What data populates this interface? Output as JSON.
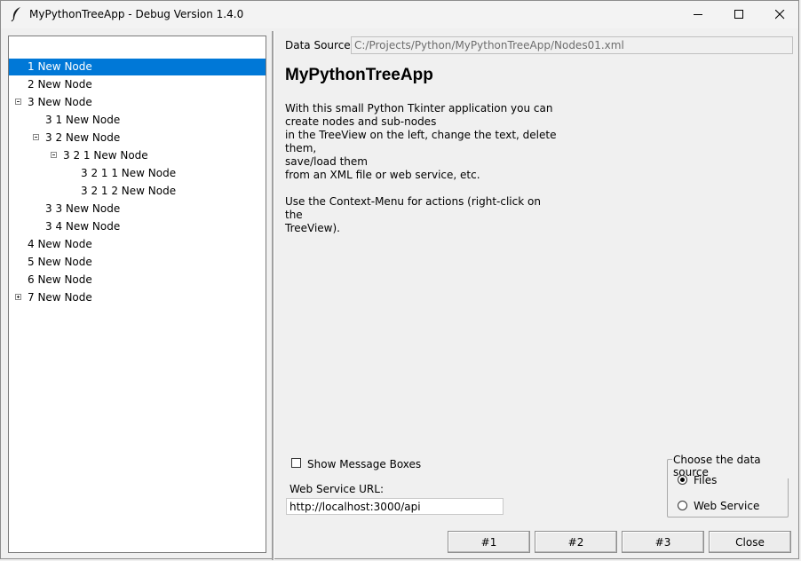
{
  "window": {
    "title": "MyPythonTreeApp - Debug Version 1.4.0"
  },
  "tree": {
    "nodes": [
      {
        "label": "1 New Node",
        "selected": true
      },
      {
        "label": "2 New Node"
      },
      {
        "label": "3 New Node",
        "expander": "minus"
      },
      {
        "label": "3 1 New Node"
      },
      {
        "label": "3 2 New Node",
        "expander": "minus"
      },
      {
        "label": "3 2 1 New Node",
        "expander": "minus"
      },
      {
        "label": "3 2 1 1 New Node"
      },
      {
        "label": "3 2 1 2 New Node"
      },
      {
        "label": "3 3 New Node"
      },
      {
        "label": "3 4 New Node"
      },
      {
        "label": "4 New Node"
      },
      {
        "label": "5 New Node"
      },
      {
        "label": "6 New Node"
      },
      {
        "label": "7 New Node",
        "expander": "plus"
      }
    ]
  },
  "data_source": {
    "label": "Data Source:",
    "value": "C:/Projects/Python/MyPythonTreeApp/Nodes01.xml"
  },
  "main": {
    "heading": "MyPythonTreeApp",
    "description": "With this small Python Tkinter application you can\ncreate nodes and sub-nodes\nin the TreeView on the left, change the text, delete them,\nsave/load them\nfrom an XML file or web service, etc.\n\nUse the Context-Menu for actions (right-click on the\nTreeView)."
  },
  "options": {
    "show_message_boxes_label": "Show Message Boxes",
    "show_message_boxes_checked": false,
    "web_service_url_label": "Web Service URL:",
    "web_service_url": "http://localhost:3000/api"
  },
  "source_group": {
    "title": "Choose the data source",
    "options": [
      {
        "label": "Files",
        "selected": true
      },
      {
        "label": "Web Service",
        "selected": false
      }
    ]
  },
  "buttons": {
    "b1": "#1",
    "b2": "#2",
    "b3": "#3",
    "close": "Close"
  },
  "colors": {
    "selection": "#0078d7",
    "window_bg": "#f0f0f0"
  }
}
